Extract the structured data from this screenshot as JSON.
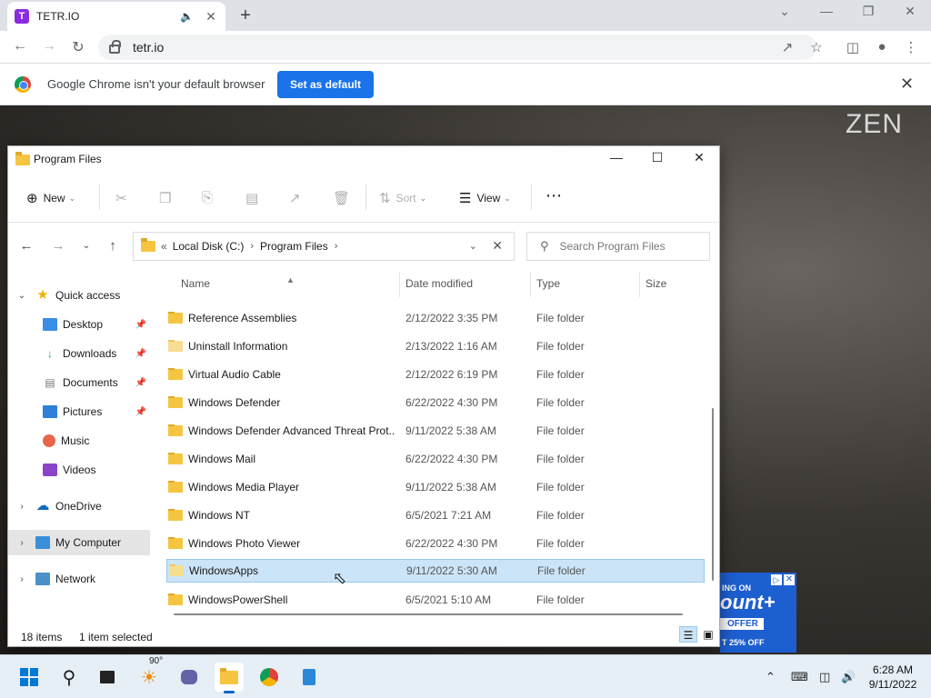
{
  "browser": {
    "tab_title": "TETR.IO",
    "favicon_letter": "T",
    "url": "tetr.io",
    "infobar_text": "Google Chrome isn't your default browser",
    "set_default_label": "Set as default"
  },
  "page": {
    "zen_label": "ZEN",
    "ad": {
      "top_text": "ING ON",
      "mid_text": "ount+",
      "offer_text": "OFFER",
      "bottom_text": "T 25% OFF"
    }
  },
  "explorer": {
    "title": "Program Files",
    "commands": {
      "new_label": "New",
      "sort_label": "Sort",
      "view_label": "View"
    },
    "address": {
      "prefix": "«",
      "crumbs": [
        "Local Disk (C:)",
        "Program Files"
      ]
    },
    "search_placeholder": "Search Program Files",
    "nav_pane": {
      "quick_access": "Quick access",
      "desktop": "Desktop",
      "downloads": "Downloads",
      "documents": "Documents",
      "pictures": "Pictures",
      "music": "Music",
      "videos": "Videos",
      "onedrive": "OneDrive",
      "my_computer": "My Computer",
      "network": "Network"
    },
    "columns": {
      "name": "Name",
      "date": "Date modified",
      "type": "Type",
      "size": "Size"
    },
    "rows": [
      {
        "name": "Reference Assemblies",
        "date": "2/12/2022 3:35 PM",
        "type": "File folder"
      },
      {
        "name": "Uninstall Information",
        "date": "2/13/2022 1:16 AM",
        "type": "File folder"
      },
      {
        "name": "Virtual Audio Cable",
        "date": "2/12/2022 6:19 PM",
        "type": "File folder"
      },
      {
        "name": "Windows Defender",
        "date": "6/22/2022 4:30 PM",
        "type": "File folder"
      },
      {
        "name": "Windows Defender Advanced Threat Prot...",
        "date": "9/11/2022 5:38 AM",
        "type": "File folder"
      },
      {
        "name": "Windows Mail",
        "date": "6/22/2022 4:30 PM",
        "type": "File folder"
      },
      {
        "name": "Windows Media Player",
        "date": "9/11/2022 5:38 AM",
        "type": "File folder"
      },
      {
        "name": "Windows NT",
        "date": "6/5/2021 7:21 AM",
        "type": "File folder"
      },
      {
        "name": "Windows Photo Viewer",
        "date": "6/22/2022 4:30 PM",
        "type": "File folder"
      },
      {
        "name": "WindowsApps",
        "date": "9/11/2022 5:30 AM",
        "type": "File folder"
      },
      {
        "name": "WindowsPowerShell",
        "date": "6/5/2021 5:10 AM",
        "type": "File folder"
      }
    ],
    "status": {
      "count": "18 items",
      "selected": "1 item selected"
    }
  },
  "taskbar": {
    "weather": "90°",
    "time": "6:28 AM",
    "date": "9/11/2022"
  }
}
